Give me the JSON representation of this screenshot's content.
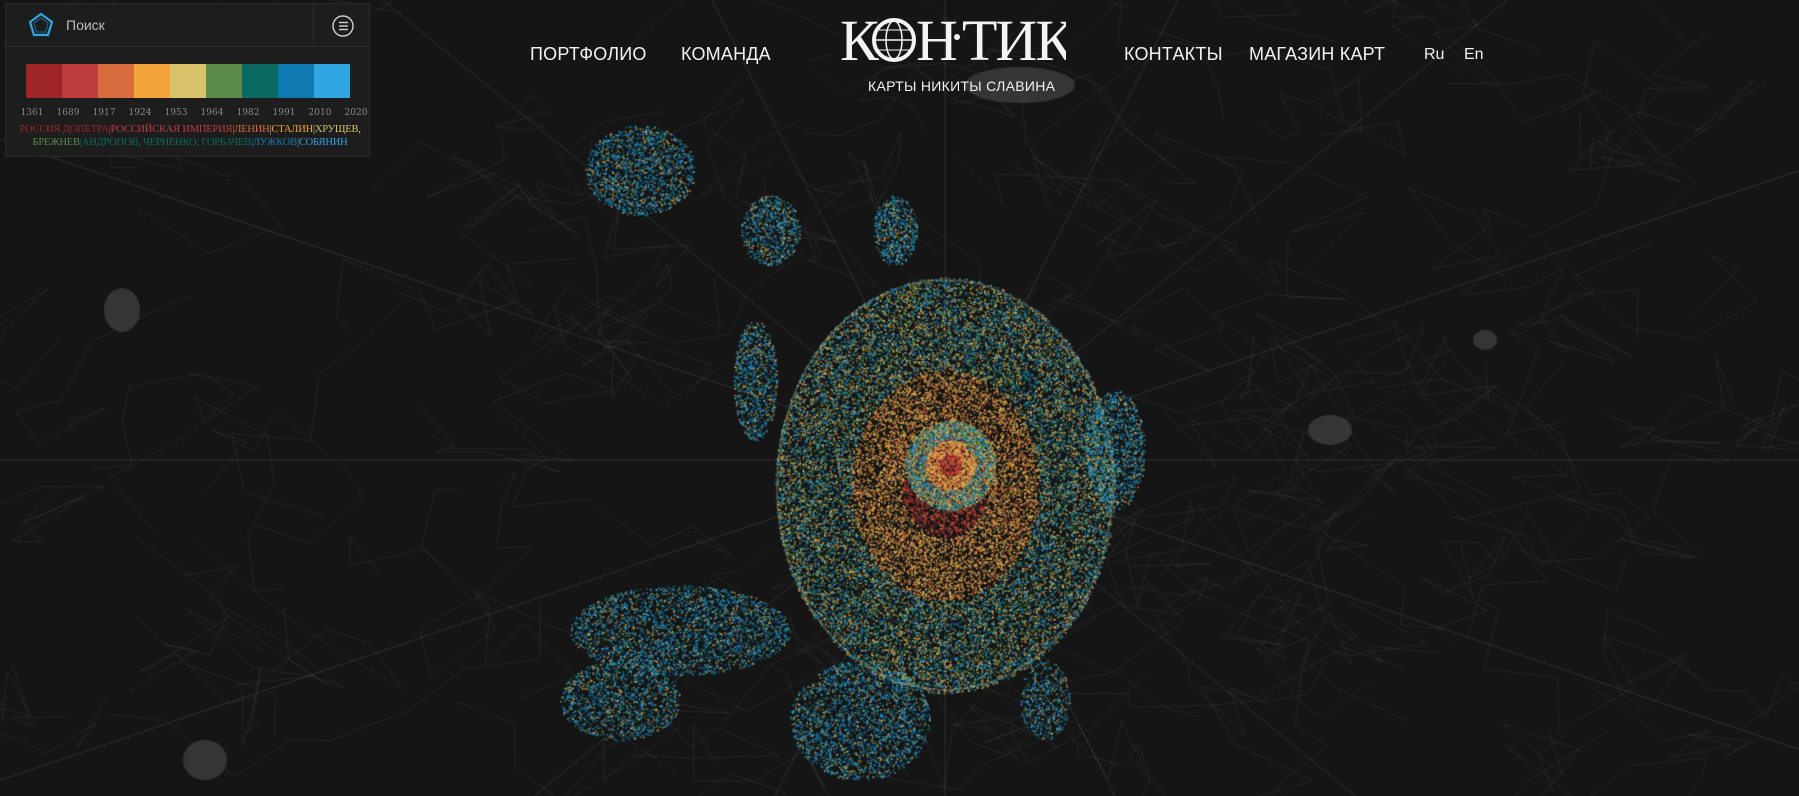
{
  "app": {
    "logo_text": "КОН-ТИКИ",
    "subtitle": "КАРТЫ НИКИТЫ СЛАВИНА"
  },
  "nav": {
    "portfolio": "ПОРТФОЛИО",
    "team": "КОМАНДА",
    "contacts": "КОНТАКТЫ",
    "shop": "МАГАЗИН КАРТ",
    "lang_ru": "Ru",
    "lang_en": "En"
  },
  "search": {
    "placeholder": "Поиск",
    "logo_icon": "pentagon-logo-icon",
    "layers_icon": "layers-list-icon"
  },
  "legend": {
    "colors": [
      "#9e2525",
      "#bf3c3c",
      "#d86c3f",
      "#f2a33a",
      "#d8c26a",
      "#5b8a4b",
      "#0a6a62",
      "#0f7ab2",
      "#2fa6e2"
    ],
    "ticks": [
      "1361",
      "1689",
      "1917",
      "1924",
      "1953",
      "1964",
      "1982",
      "1991",
      "2010",
      "2020"
    ],
    "eras": [
      {
        "label": "РОССИЯ ДОПЕТРА",
        "color": "#9e2525"
      },
      {
        "label": "|",
        "color": "#bf3c3c"
      },
      {
        "label": "РОССИЙСКАЯ ИМПЕРИЯ",
        "color": "#bf3c3c"
      },
      {
        "label": "|",
        "color": "#d86c3f"
      },
      {
        "label": "ЛЕНИН",
        "color": "#d86c3f"
      },
      {
        "label": "|",
        "color": "#f2a33a"
      },
      {
        "label": "СТАЛИН",
        "color": "#f2a33a"
      },
      {
        "label": "|",
        "color": "#d8c26a"
      },
      {
        "label": "ХРУЩЕВ,",
        "color": "#d8c26a"
      },
      {
        "label": "БРЕЖНЕВ",
        "color": "#5b8a4b"
      },
      {
        "label": "|",
        "color": "#0a6a62"
      },
      {
        "label": "АНДРОПОВ, ЧЕРНЕНКО, ГОРБАЧЕВ",
        "color": "#0a6a62"
      },
      {
        "label": "|",
        "color": "#0f7ab2"
      },
      {
        "label": "ЛУЖКОВ",
        "color": "#0f7ab2"
      },
      {
        "label": "|",
        "color": "#2fa6e2"
      },
      {
        "label": "СОБЯНИН",
        "color": "#2fa6e2"
      }
    ]
  }
}
